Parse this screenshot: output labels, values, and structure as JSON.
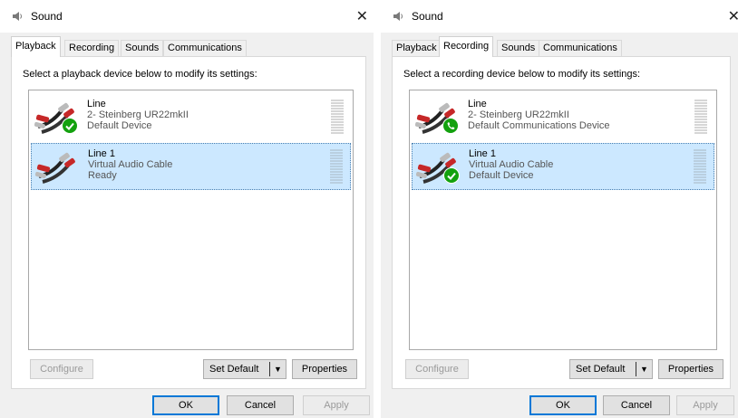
{
  "left": {
    "title": "Sound",
    "tabs": [
      "Playback",
      "Recording",
      "Sounds",
      "Communications"
    ],
    "active_tab": 0,
    "instruction": "Select a playback device below to modify its settings:",
    "devices": [
      {
        "name": "Line",
        "line2": "2- Steinberg UR22mkII",
        "line3": "Default Device",
        "badge": "check-icon",
        "selected": false
      },
      {
        "name": "Line 1",
        "line2": "Virtual Audio Cable",
        "line3": "Ready",
        "badge": "",
        "selected": true
      }
    ],
    "buttons": {
      "configure": "Configure",
      "set_default": "Set Default",
      "properties": "Properties",
      "ok": "OK",
      "cancel": "Cancel",
      "apply": "Apply"
    }
  },
  "right": {
    "title": "Sound",
    "tabs": [
      "Playback",
      "Recording",
      "Sounds",
      "Communications"
    ],
    "active_tab": 1,
    "instruction": "Select a recording device below to modify its settings:",
    "devices": [
      {
        "name": "Line",
        "line2": "2- Steinberg UR22mkII",
        "line3": "Default Communications Device",
        "badge": "phone-icon",
        "selected": false
      },
      {
        "name": "Line 1",
        "line2": "Virtual Audio Cable",
        "line3": "Default Device",
        "badge": "check-icon",
        "selected": true
      }
    ],
    "buttons": {
      "configure": "Configure",
      "set_default": "Set Default",
      "properties": "Properties",
      "ok": "OK",
      "cancel": "Cancel",
      "apply": "Apply"
    }
  },
  "colors": {
    "selection": "#cce8ff",
    "badge_green": "#13a10e",
    "accent": "#0078d7"
  }
}
